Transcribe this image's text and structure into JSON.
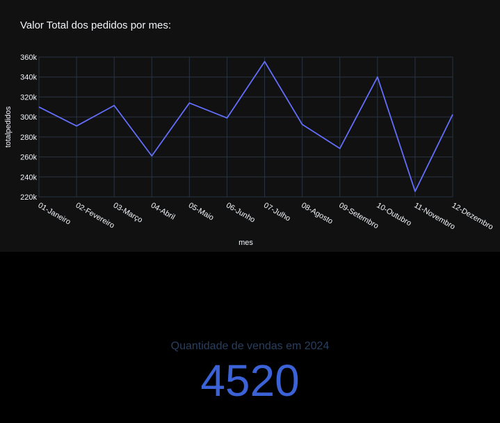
{
  "chart_data": {
    "type": "line",
    "title": "Valor Total dos pedidos por mes:",
    "xlabel": "mes",
    "ylabel": "totalpedidos",
    "categories": [
      "01-Janeiro",
      "02-Fevereiro",
      "03-Março",
      "04-Abril",
      "05-Maio",
      "06-Junho",
      "07-Julho",
      "08-Agosto",
      "09-Setembro",
      "10-Outubro",
      "11-Novembro",
      "12-Dezembro"
    ],
    "series": [
      {
        "values": [
          310000,
          291000,
          311500,
          261000,
          314000,
          299000,
          355500,
          292500,
          268500,
          340000,
          225500,
          302500
        ],
        "color": "#636efa"
      }
    ],
    "ylim": [
      220000,
      360000
    ],
    "yticks": [
      220000,
      240000,
      260000,
      280000,
      300000,
      320000,
      340000,
      360000
    ],
    "ytick_labels": [
      "220k",
      "240k",
      "260k",
      "280k",
      "300k",
      "320k",
      "340k",
      "360k"
    ],
    "grid": true,
    "colors": {
      "panel_bg": "#111111",
      "grid": "#283442",
      "text": "#f2f5fa"
    }
  },
  "kpi": {
    "label": "Quantidade de vendas em 2024",
    "value": "4520",
    "label_color": "#2a3f5f",
    "value_color": "#3b62d6"
  }
}
